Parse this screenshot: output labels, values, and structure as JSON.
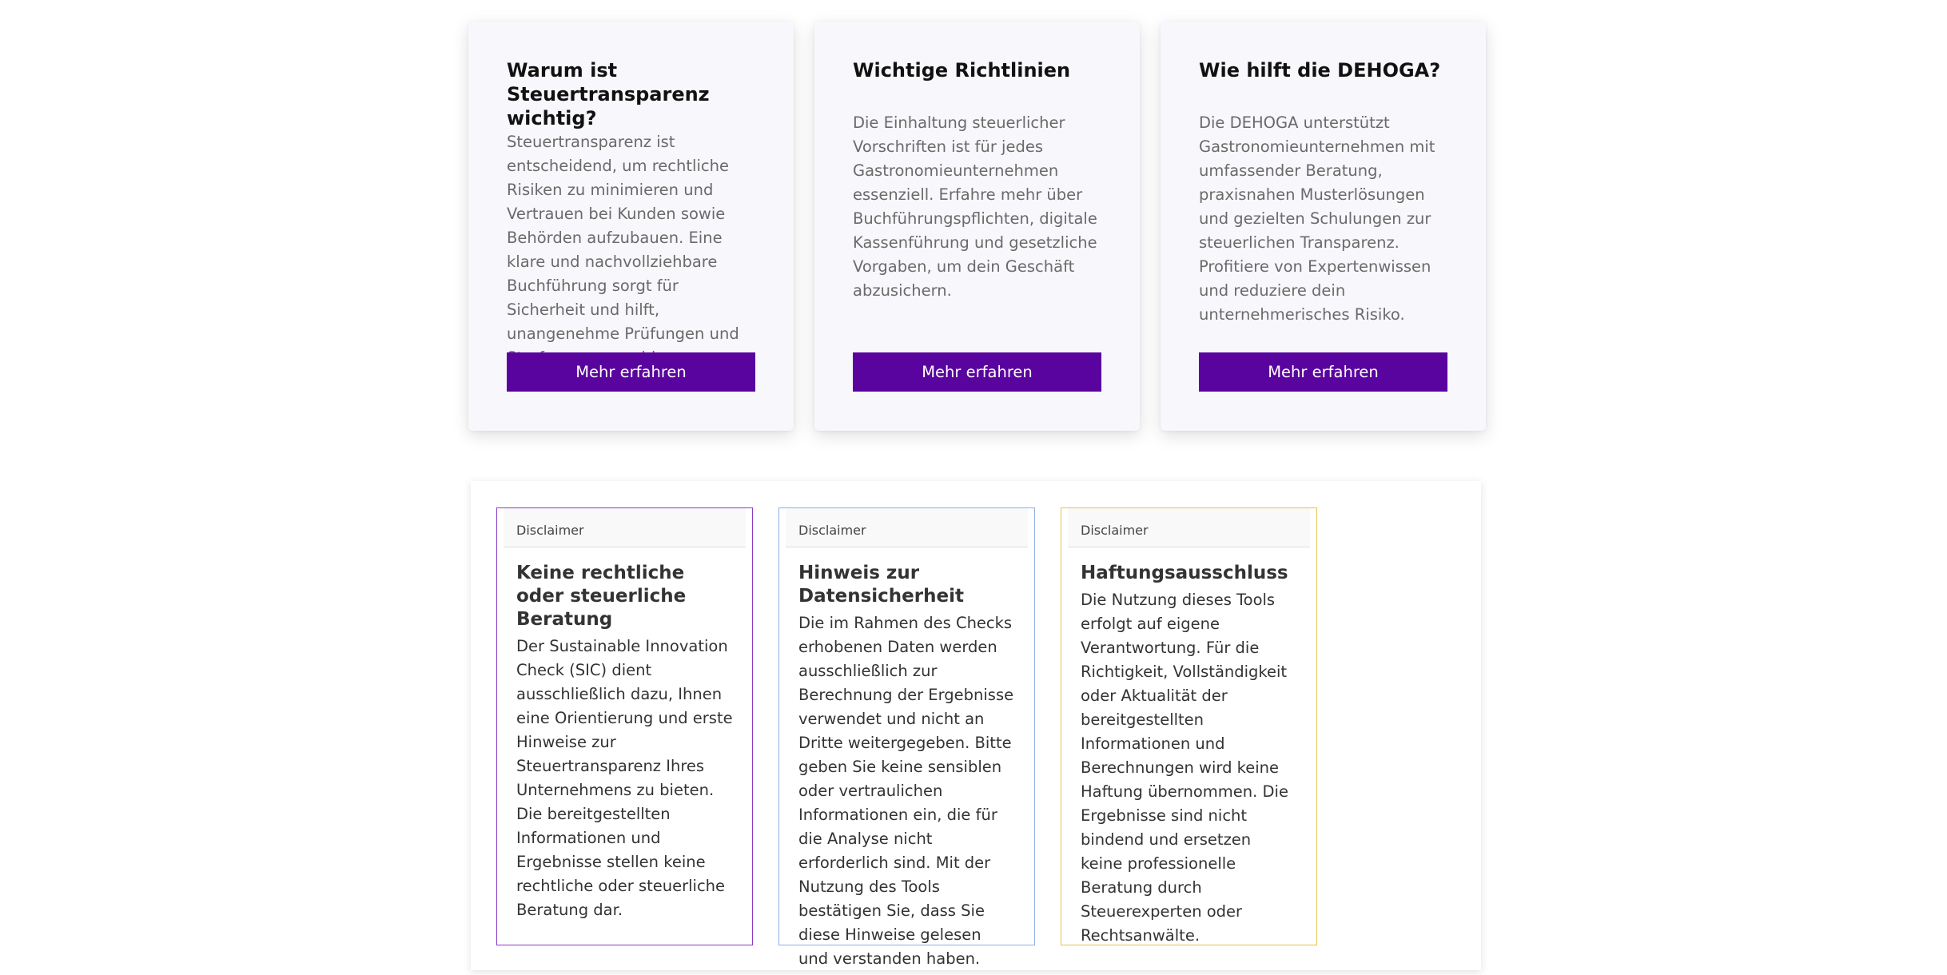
{
  "info_cards": [
    {
      "title": "Warum ist Steuertransparenz wichtig?",
      "text": "Steuertransparenz ist entscheidend, um rechtliche Risiken zu minimieren und Vertrauen bei Kunden sowie Behörden aufzubauen. Eine klare und nachvollziehbare Buchführung sorgt für Sicherheit und hilft, unangenehme Prüfungen und Strafen zu vermeiden.",
      "button": "Mehr erfahren"
    },
    {
      "title": "Wichtige Richtlinien",
      "text": "Die Einhaltung steuerlicher Vorschriften ist für jedes Gastronomieunternehmen essenziell. Erfahre mehr über Buchführungspflichten, digitale Kassenführung und gesetzliche Vorgaben, um dein Geschäft abzusichern.",
      "button": "Mehr erfahren"
    },
    {
      "title": "Wie hilft die DEHOGA?",
      "text": "Die DEHOGA unterstützt Gastronomieunternehmen mit umfassender Beratung, praxisnahen Musterlösungen und gezielten Schulungen zur steuerlichen Transparenz. Profitiere von Expertenwissen und reduziere dein unternehmerisches Risiko.",
      "button": "Mehr erfahren"
    }
  ],
  "disclaimers": [
    {
      "tag": "Disclaimer",
      "title": "Keine rechtliche oder steuerliche Beratung",
      "text": "Der Sustainable Innovation Check (SIC) dient ausschließlich dazu, Ihnen eine Orientierung und erste Hinweise zur Steuertransparenz Ihres Unternehmens zu bieten. Die bereitgestellten Informationen und Ergebnisse stellen keine rechtliche oder steuerliche Beratung dar."
    },
    {
      "tag": "Disclaimer",
      "title": "Hinweis zur Datensicherheit",
      "text": "Die im Rahmen des Checks erhobenen Daten werden ausschließlich zur Berechnung der Ergebnisse verwendet und nicht an Dritte weitergegeben. Bitte geben Sie keine sensiblen oder vertraulichen Informationen ein, die für die Analyse nicht erforderlich sind. Mit der Nutzung des Tools bestätigen Sie, dass Sie diese Hinweise gelesen und verstanden haben."
    },
    {
      "tag": "Disclaimer",
      "title": "Haftungsausschluss",
      "text": "Die Nutzung dieses Tools erfolgt auf eigene Verantwortung. Für die Richtigkeit, Vollständigkeit oder Aktualität der bereitgestellten Informationen und Berechnungen wird keine Haftung übernommen. Die Ergebnisse sind nicht bindend und ersetzen keine professionelle Beratung durch Steuerexperten oder Rechtsanwälte."
    }
  ],
  "colors": {
    "button": "#5a049f",
    "disclaimer_border_1": "#8a3ac4",
    "disclaimer_border_2": "#8fb0e2",
    "disclaimer_border_3": "#e3c34a"
  }
}
